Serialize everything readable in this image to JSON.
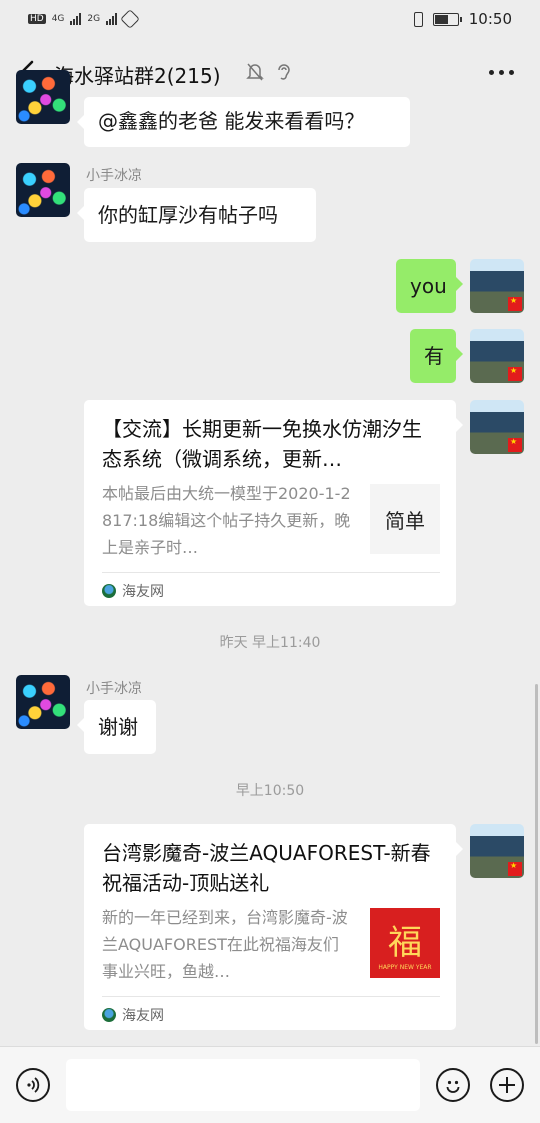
{
  "status": {
    "left_badges": [
      "HD",
      "4G",
      "2G"
    ],
    "time": "10:50"
  },
  "header": {
    "title": "海水驿站群2(215)"
  },
  "messages": {
    "m0_text": "@鑫鑫的老爸  能发来看看吗？",
    "m1_sender": "小手冰凉",
    "m1_text": "你的缸厚沙有帖子吗",
    "m2_text": "you",
    "m3_text": "有",
    "card1": {
      "title": "【交流】长期更新一免换水仿潮汐生态系统（微调系统，更新…",
      "desc": "本帖最后由大统一模型于2020-1-2817:18编辑这个帖子持久更新，晚上是亲子时…",
      "thumb_text": "简单",
      "source": "海友网"
    },
    "time1": "昨天 早上11:40",
    "m5_sender": "小手冰凉",
    "m5_text": "谢谢",
    "time2": "早上10:50",
    "card2": {
      "title": "台湾影魔奇-波兰AQUAFOREST-新春祝福活动-顶贴送礼",
      "desc": "新的一年已经到来，台湾影魔奇-波兰AQUAFOREST在此祝福海友们事业兴旺，鱼越…",
      "thumb_text": "福",
      "thumb_small": "HAPPY NEW YEAR",
      "source": "海友网"
    }
  },
  "input": {
    "value": ""
  },
  "colors": {
    "bg": "#ededed",
    "out_bubble": "#95ec69",
    "in_bubble": "#ffffff"
  },
  "icons": [
    "back-arrow-icon",
    "mute-bell-icon",
    "ear-icon",
    "more-icon",
    "voice-icon",
    "emoji-icon",
    "plus-icon"
  ]
}
